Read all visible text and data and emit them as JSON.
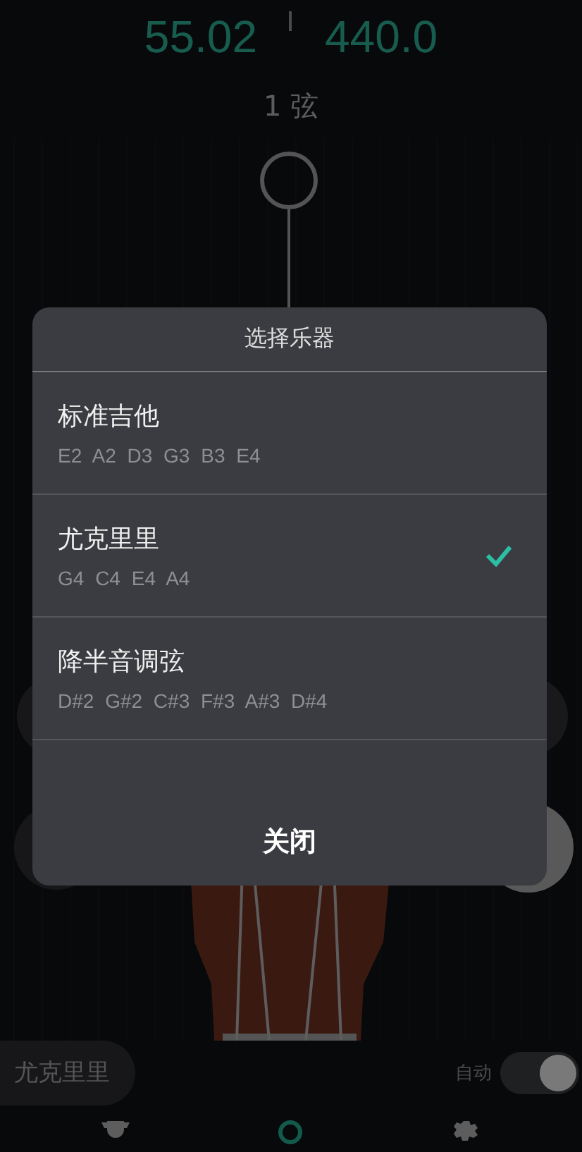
{
  "tuner": {
    "readings": [
      "55.02",
      "440.0"
    ],
    "string_label": "1 弦"
  },
  "instrument_button": "尤克里里",
  "auto_toggle": {
    "label": "自动",
    "on": true
  },
  "nav": [
    {
      "kind": "trophy",
      "selected": false
    },
    {
      "kind": "tuner",
      "selected": true
    },
    {
      "kind": "settings",
      "selected": false
    }
  ],
  "dialog": {
    "title": "选择乐器",
    "options": [
      {
        "name": "标准吉他",
        "notes": "E2 A2 D3 G3 B3 E4",
        "selected": false
      },
      {
        "name": "尤克里里",
        "notes": "G4 C4 E4 A4",
        "selected": true
      },
      {
        "name": "降半音调弦",
        "notes": "D#2 G#2 C#3 F#3 A#3 D#4",
        "selected": false
      }
    ],
    "close_button": "关闭"
  }
}
